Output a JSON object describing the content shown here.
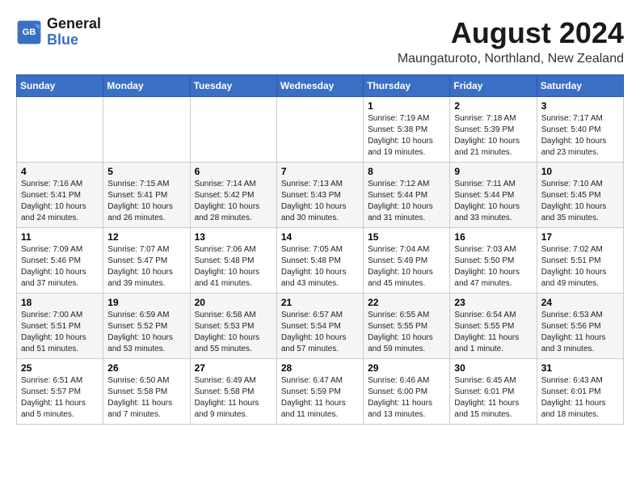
{
  "logo": {
    "line1": "General",
    "line2": "Blue"
  },
  "title": "August 2024",
  "location": "Maungaturoto, Northland, New Zealand",
  "days_of_week": [
    "Sunday",
    "Monday",
    "Tuesday",
    "Wednesday",
    "Thursday",
    "Friday",
    "Saturday"
  ],
  "weeks": [
    [
      {
        "day": "",
        "info": ""
      },
      {
        "day": "",
        "info": ""
      },
      {
        "day": "",
        "info": ""
      },
      {
        "day": "",
        "info": ""
      },
      {
        "day": "1",
        "info": "Sunrise: 7:19 AM\nSunset: 5:38 PM\nDaylight: 10 hours\nand 19 minutes."
      },
      {
        "day": "2",
        "info": "Sunrise: 7:18 AM\nSunset: 5:39 PM\nDaylight: 10 hours\nand 21 minutes."
      },
      {
        "day": "3",
        "info": "Sunrise: 7:17 AM\nSunset: 5:40 PM\nDaylight: 10 hours\nand 23 minutes."
      }
    ],
    [
      {
        "day": "4",
        "info": "Sunrise: 7:16 AM\nSunset: 5:41 PM\nDaylight: 10 hours\nand 24 minutes."
      },
      {
        "day": "5",
        "info": "Sunrise: 7:15 AM\nSunset: 5:41 PM\nDaylight: 10 hours\nand 26 minutes."
      },
      {
        "day": "6",
        "info": "Sunrise: 7:14 AM\nSunset: 5:42 PM\nDaylight: 10 hours\nand 28 minutes."
      },
      {
        "day": "7",
        "info": "Sunrise: 7:13 AM\nSunset: 5:43 PM\nDaylight: 10 hours\nand 30 minutes."
      },
      {
        "day": "8",
        "info": "Sunrise: 7:12 AM\nSunset: 5:44 PM\nDaylight: 10 hours\nand 31 minutes."
      },
      {
        "day": "9",
        "info": "Sunrise: 7:11 AM\nSunset: 5:44 PM\nDaylight: 10 hours\nand 33 minutes."
      },
      {
        "day": "10",
        "info": "Sunrise: 7:10 AM\nSunset: 5:45 PM\nDaylight: 10 hours\nand 35 minutes."
      }
    ],
    [
      {
        "day": "11",
        "info": "Sunrise: 7:09 AM\nSunset: 5:46 PM\nDaylight: 10 hours\nand 37 minutes."
      },
      {
        "day": "12",
        "info": "Sunrise: 7:07 AM\nSunset: 5:47 PM\nDaylight: 10 hours\nand 39 minutes."
      },
      {
        "day": "13",
        "info": "Sunrise: 7:06 AM\nSunset: 5:48 PM\nDaylight: 10 hours\nand 41 minutes."
      },
      {
        "day": "14",
        "info": "Sunrise: 7:05 AM\nSunset: 5:48 PM\nDaylight: 10 hours\nand 43 minutes."
      },
      {
        "day": "15",
        "info": "Sunrise: 7:04 AM\nSunset: 5:49 PM\nDaylight: 10 hours\nand 45 minutes."
      },
      {
        "day": "16",
        "info": "Sunrise: 7:03 AM\nSunset: 5:50 PM\nDaylight: 10 hours\nand 47 minutes."
      },
      {
        "day": "17",
        "info": "Sunrise: 7:02 AM\nSunset: 5:51 PM\nDaylight: 10 hours\nand 49 minutes."
      }
    ],
    [
      {
        "day": "18",
        "info": "Sunrise: 7:00 AM\nSunset: 5:51 PM\nDaylight: 10 hours\nand 51 minutes."
      },
      {
        "day": "19",
        "info": "Sunrise: 6:59 AM\nSunset: 5:52 PM\nDaylight: 10 hours\nand 53 minutes."
      },
      {
        "day": "20",
        "info": "Sunrise: 6:58 AM\nSunset: 5:53 PM\nDaylight: 10 hours\nand 55 minutes."
      },
      {
        "day": "21",
        "info": "Sunrise: 6:57 AM\nSunset: 5:54 PM\nDaylight: 10 hours\nand 57 minutes."
      },
      {
        "day": "22",
        "info": "Sunrise: 6:55 AM\nSunset: 5:55 PM\nDaylight: 10 hours\nand 59 minutes."
      },
      {
        "day": "23",
        "info": "Sunrise: 6:54 AM\nSunset: 5:55 PM\nDaylight: 11 hours\nand 1 minute."
      },
      {
        "day": "24",
        "info": "Sunrise: 6:53 AM\nSunset: 5:56 PM\nDaylight: 11 hours\nand 3 minutes."
      }
    ],
    [
      {
        "day": "25",
        "info": "Sunrise: 6:51 AM\nSunset: 5:57 PM\nDaylight: 11 hours\nand 5 minutes."
      },
      {
        "day": "26",
        "info": "Sunrise: 6:50 AM\nSunset: 5:58 PM\nDaylight: 11 hours\nand 7 minutes."
      },
      {
        "day": "27",
        "info": "Sunrise: 6:49 AM\nSunset: 5:58 PM\nDaylight: 11 hours\nand 9 minutes."
      },
      {
        "day": "28",
        "info": "Sunrise: 6:47 AM\nSunset: 5:59 PM\nDaylight: 11 hours\nand 11 minutes."
      },
      {
        "day": "29",
        "info": "Sunrise: 6:46 AM\nSunset: 6:00 PM\nDaylight: 11 hours\nand 13 minutes."
      },
      {
        "day": "30",
        "info": "Sunrise: 6:45 AM\nSunset: 6:01 PM\nDaylight: 11 hours\nand 15 minutes."
      },
      {
        "day": "31",
        "info": "Sunrise: 6:43 AM\nSunset: 6:01 PM\nDaylight: 11 hours\nand 18 minutes."
      }
    ]
  ]
}
